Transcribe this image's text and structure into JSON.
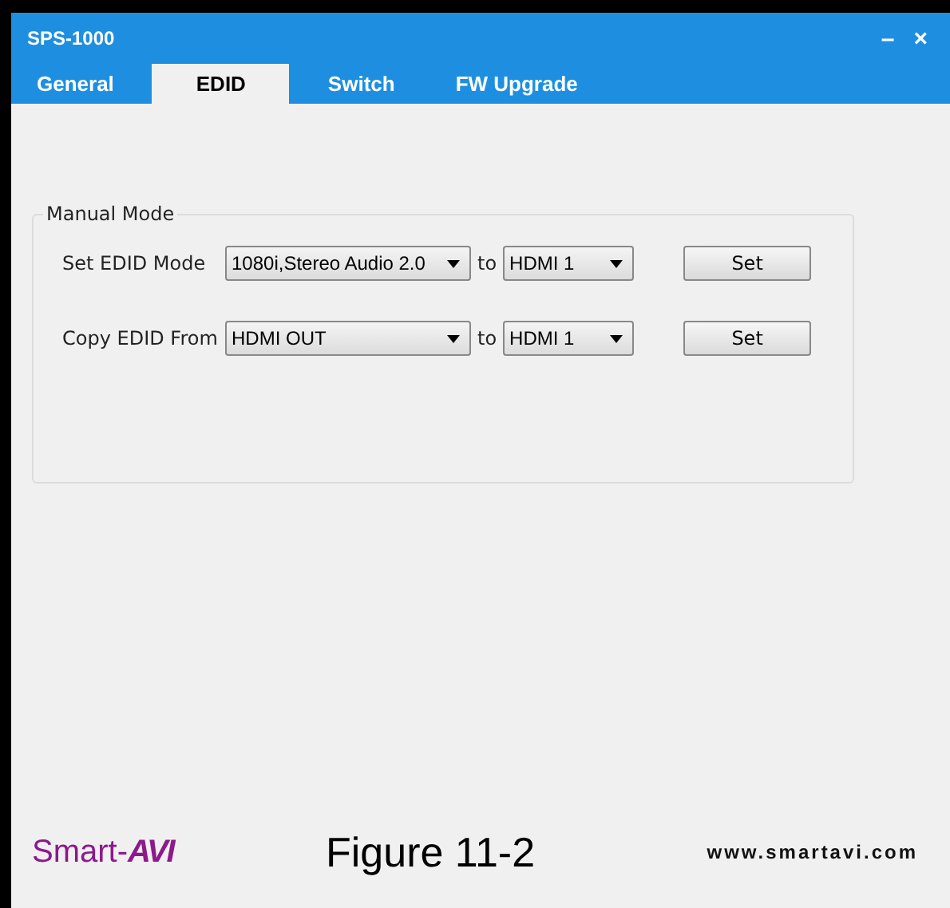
{
  "window": {
    "title": "SPS-1000",
    "minimize": "–",
    "close": "×"
  },
  "tabs": [
    {
      "label": "General",
      "selected": false
    },
    {
      "label": "EDID",
      "selected": true
    },
    {
      "label": "Switch",
      "selected": false
    },
    {
      "label": "FW Upgrade",
      "selected": false
    }
  ],
  "group": {
    "title": "Manual Mode",
    "rows": [
      {
        "label": "Set EDID Mode",
        "source": "1080i,Stereo Audio 2.0",
        "to": "to",
        "target": "HDMI 1",
        "button": "Set"
      },
      {
        "label": "Copy EDID From",
        "source": "HDMI OUT",
        "to": "to",
        "target": "HDMI 1",
        "button": "Set"
      }
    ]
  },
  "footer": {
    "logo": "Smart-",
    "logo_mark": "AVI",
    "caption": "Figure 11-2",
    "url": "www.smartavi.com"
  }
}
